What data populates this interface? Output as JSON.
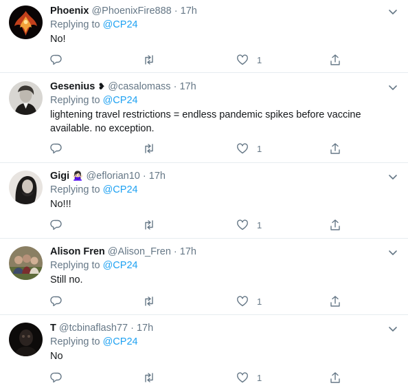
{
  "tweets": [
    {
      "name": "Phoenix",
      "name_emoji": "",
      "handle": "@PhoenixFire888",
      "time": "17h",
      "replying_prefix": "Replying to",
      "replying_to": "@CP24",
      "text": "No!",
      "likes": "1",
      "avatar_style": "phoenix"
    },
    {
      "name": "Gesenius",
      "name_emoji": "❥",
      "handle": "@casalomass",
      "time": "17h",
      "replying_prefix": "Replying to",
      "replying_to": "@CP24",
      "text": "lightening travel restrictions = endless pandemic spikes before vaccine available. no exception.",
      "likes": "1",
      "avatar_style": "portrait"
    },
    {
      "name": "Gigi",
      "name_emoji": "🙅🏻‍♀️",
      "handle": "@eflorian10",
      "time": "17h",
      "replying_prefix": "Replying to",
      "replying_to": "@CP24",
      "text": "No!!!",
      "likes": "1",
      "avatar_style": "woman"
    },
    {
      "name": "Alison Fren",
      "name_emoji": "",
      "handle": "@Alison_Fren",
      "time": "17h",
      "replying_prefix": "Replying to",
      "replying_to": "@CP24",
      "text": "Still no.",
      "likes": "1",
      "avatar_style": "group"
    },
    {
      "name": "T",
      "name_emoji": "",
      "handle": "@tcbinaflash77",
      "time": "17h",
      "replying_prefix": "Replying to",
      "replying_to": "@CP24",
      "text": "No",
      "likes": "1",
      "avatar_style": "dark"
    }
  ],
  "icons": {
    "reply": "reply-icon",
    "retweet": "retweet-icon",
    "like": "heart-icon",
    "share": "share-icon",
    "more": "chevron-down-icon"
  },
  "colors": {
    "link": "#1da1f2",
    "secondary_text": "#657786",
    "divider": "#e6ecf0"
  }
}
